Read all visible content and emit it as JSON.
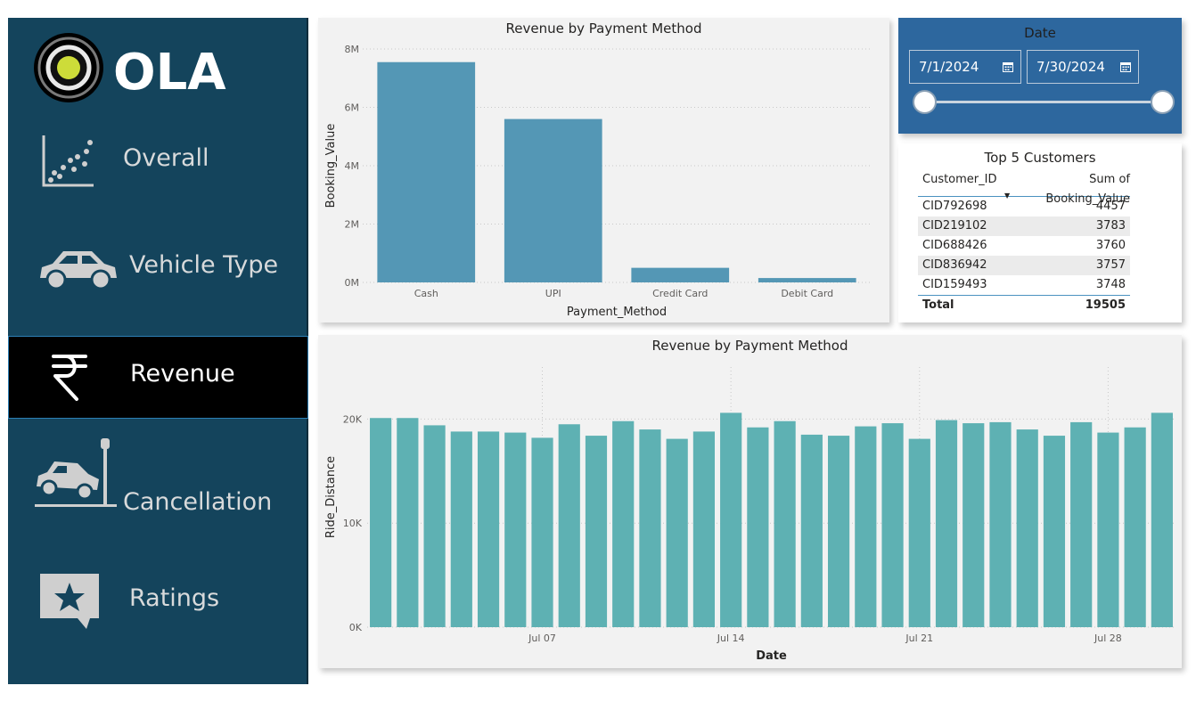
{
  "sidebar": {
    "logo_text": "OLA",
    "items": [
      {
        "label": "Overall",
        "icon": "scatter-chart-icon",
        "active": false
      },
      {
        "label": "Vehicle Type",
        "icon": "car-icon",
        "active": false
      },
      {
        "label": "Revenue",
        "icon": "rupee-icon",
        "active": true
      },
      {
        "label": "Cancellation",
        "icon": "car-crash-icon",
        "active": false
      },
      {
        "label": "Ratings",
        "icon": "star-comment-icon",
        "active": false
      }
    ]
  },
  "date_slicer": {
    "title": "Date",
    "start": "7/1/2024",
    "end": "7/30/2024"
  },
  "top_customers": {
    "title": "Top 5 Customers",
    "columns": [
      "Customer_ID",
      "Sum of Booking_Value"
    ],
    "rows": [
      {
        "id": "CID792698",
        "value": "4457"
      },
      {
        "id": "CID219102",
        "value": "3783"
      },
      {
        "id": "CID688426",
        "value": "3760"
      },
      {
        "id": "CID836942",
        "value": "3757"
      },
      {
        "id": "CID159493",
        "value": "3748"
      }
    ],
    "total_label": "Total",
    "total_value": "19505"
  },
  "colors": {
    "sidebar_bg": "#14445c",
    "bar_payment": "#5497b5",
    "bar_daily": "#5eb1b3",
    "slicer_bg": "#2d679e"
  },
  "chart_data": [
    {
      "type": "bar",
      "title": "Revenue by Payment Method",
      "xlabel": "Payment_Method",
      "ylabel": "Booking_Value",
      "categories": [
        "Cash",
        "UPI",
        "Credit Card",
        "Debit Card"
      ],
      "values": [
        7550000,
        5600000,
        500000,
        150000
      ],
      "ylim": [
        0,
        8000000
      ],
      "yticks": [
        0,
        2000000,
        4000000,
        6000000,
        8000000
      ],
      "ytick_labels": [
        "0M",
        "2M",
        "4M",
        "6M",
        "8M"
      ],
      "grid": true
    },
    {
      "type": "bar",
      "title": "Revenue by Payment Method",
      "xlabel": "Date",
      "ylabel": "Ride_Distance",
      "x": [
        "2024-07-01",
        "2024-07-02",
        "2024-07-03",
        "2024-07-04",
        "2024-07-05",
        "2024-07-06",
        "2024-07-07",
        "2024-07-08",
        "2024-07-09",
        "2024-07-10",
        "2024-07-11",
        "2024-07-12",
        "2024-07-13",
        "2024-07-14",
        "2024-07-15",
        "2024-07-16",
        "2024-07-17",
        "2024-07-18",
        "2024-07-19",
        "2024-07-20",
        "2024-07-21",
        "2024-07-22",
        "2024-07-23",
        "2024-07-24",
        "2024-07-25",
        "2024-07-26",
        "2024-07-27",
        "2024-07-28",
        "2024-07-29",
        "2024-07-30"
      ],
      "values": [
        20100,
        20100,
        19400,
        18800,
        18800,
        18700,
        18200,
        19500,
        18400,
        19800,
        19000,
        18100,
        18800,
        20600,
        19200,
        19800,
        18500,
        18400,
        19300,
        19600,
        18100,
        19900,
        19600,
        19700,
        19000,
        18400,
        19700,
        18700,
        19200,
        20600
      ],
      "ylim": [
        0,
        25000
      ],
      "yticks": [
        0,
        10000,
        20000
      ],
      "ytick_labels": [
        "0K",
        "10K",
        "20K"
      ],
      "xticks": [
        "Jul 07",
        "Jul 14",
        "Jul 21",
        "Jul 28"
      ],
      "grid": true
    }
  ]
}
